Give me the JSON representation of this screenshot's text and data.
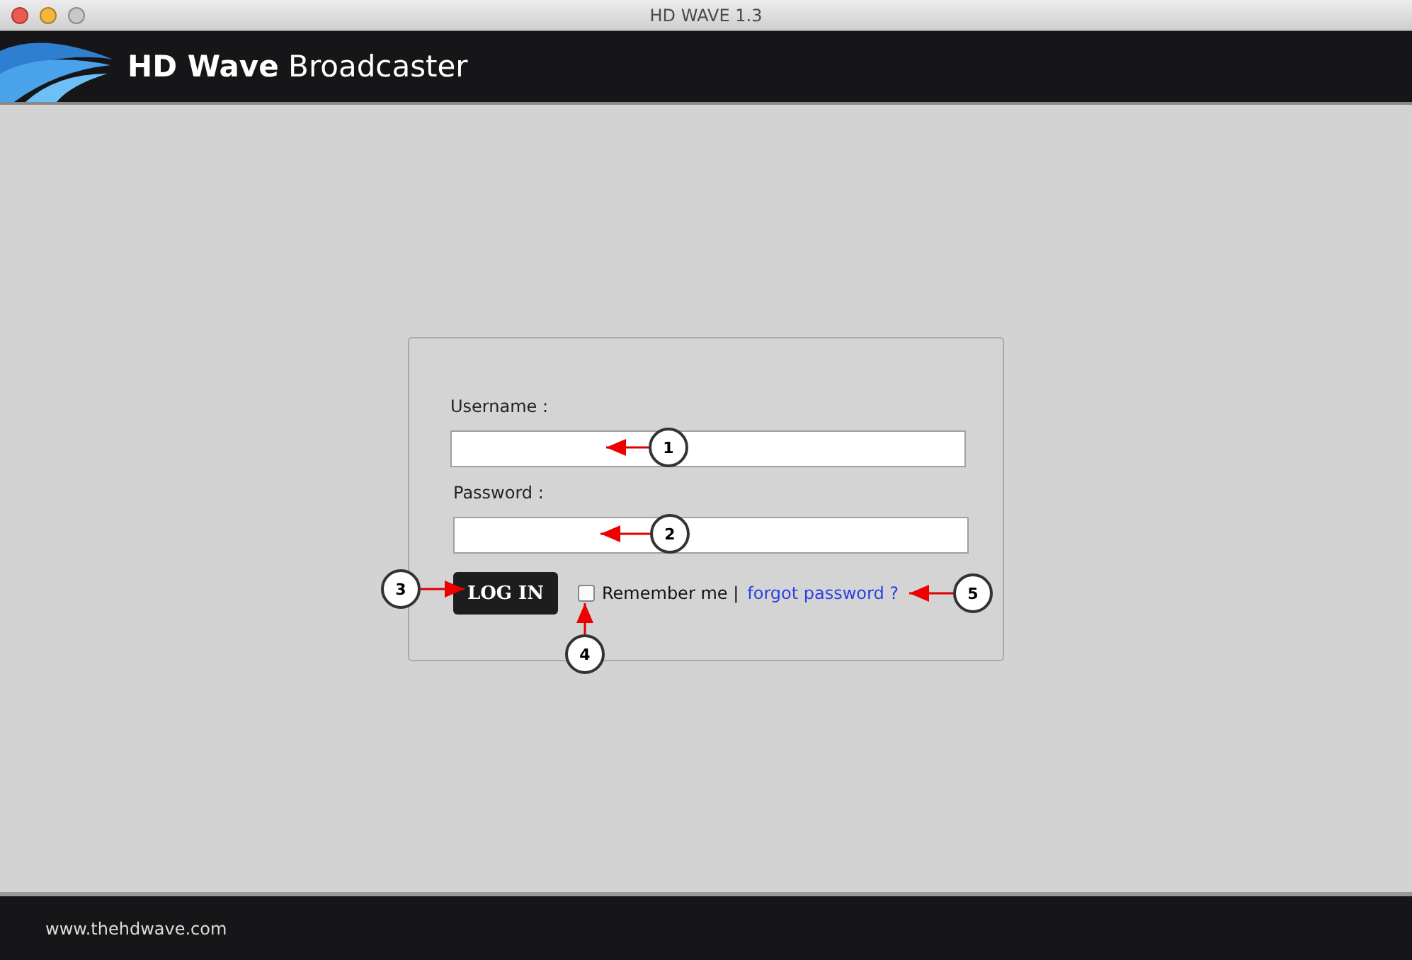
{
  "window": {
    "title": "HD WAVE 1.3"
  },
  "header": {
    "brand_bold": "HD Wave",
    "brand_light": "Broadcaster"
  },
  "login": {
    "username_label": "Username :",
    "password_label": "Password :",
    "button": "LOG IN",
    "remember": {
      "label": "Remember me |",
      "checked": false
    },
    "forgot_link": "forgot password ?"
  },
  "callouts": [
    "1",
    "2",
    "3",
    "4",
    "5"
  ],
  "footer": {
    "url": "www.thehdwave.com"
  }
}
